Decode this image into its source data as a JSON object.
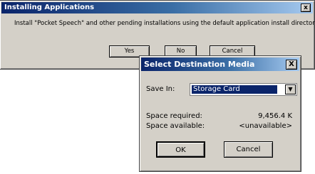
{
  "install_dialog": {
    "title": "Installing Applications",
    "close_label": "x",
    "message": "Install \"Pocket Speech\" and other pending installations using the default application install directory?",
    "buttons": {
      "yes": "Yes",
      "no": "No",
      "cancel": "Cancel"
    }
  },
  "media_dialog": {
    "title": "Select Destination Media",
    "close_label": "X",
    "save_in_label": "Save In:",
    "save_in_value": "Storage Card",
    "dropdown_arrow": "▼",
    "space_required_label": "Space required:",
    "space_required_value": "9,456.4 K",
    "space_available_label": "Space available:",
    "space_available_value": "<unavailable>",
    "buttons": {
      "ok": "OK",
      "cancel": "Cancel"
    }
  },
  "colors": {
    "title_gradient_start": "#0a246a",
    "title_gradient_end": "#a6caf0",
    "dialog_face": "#d4d0c8",
    "selection": "#0a246a"
  }
}
